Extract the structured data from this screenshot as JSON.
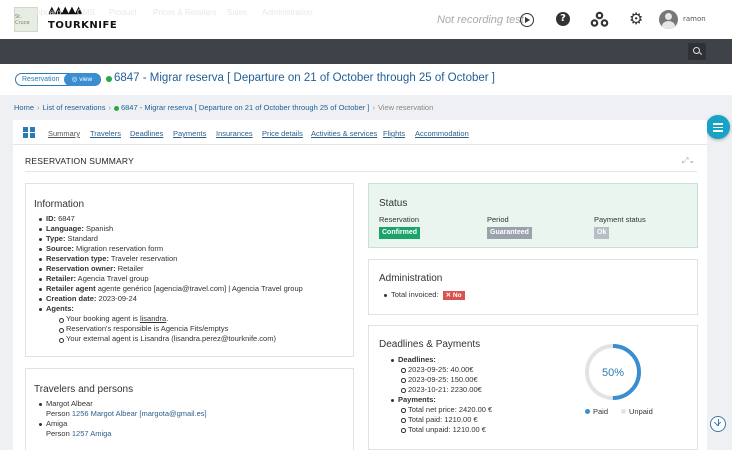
{
  "header": {
    "logo_small_text": "St. Cruce",
    "brand": "TOURKNIFE",
    "recording_status": "Not recording test",
    "username": "ramon"
  },
  "nav": {
    "items": [
      "Dashboard",
      "CMS",
      "Product",
      "Prices & Retailers",
      "Sales",
      "Administration"
    ]
  },
  "title": {
    "pill_label": "Reservation",
    "pill_view": "◎ view",
    "text": "6847 - Migrar reserva [ Departure on 21 of October through 25 of October ]"
  },
  "breadcrumb": {
    "home": "Home",
    "list": "List of reservations",
    "reservation": "6847 - Migrar reserva [ Departure on 21 of October through 25 of October ]",
    "current": "View reservation"
  },
  "tabs": [
    "Summary",
    "Travelers",
    "Deadlines",
    "Payments",
    "Insurances",
    "Price details",
    "Activities & services",
    "Flights",
    "Accommodation"
  ],
  "summary": {
    "title": "RESERVATION SUMMARY"
  },
  "information": {
    "title": "Information",
    "rows": [
      {
        "label": "ID:",
        "value": " 6847"
      },
      {
        "label": "Language:",
        "value": " Spanish"
      },
      {
        "label": "Type:",
        "value": " Standard"
      },
      {
        "label": "Source:",
        "value": " Migration reservation form"
      },
      {
        "label": "Reservation type:",
        "value": " Traveler reservation"
      },
      {
        "label": "Reservation owner:",
        "value": " Retailer"
      },
      {
        "label": "Retailer:",
        "value": " Agencia Travel group"
      },
      {
        "label": "Retailer agent",
        "value": " agente genérico [agencia@travel.com] | Agencia Travel group"
      },
      {
        "label": "Creation date:",
        "value": " 2023-09-24"
      },
      {
        "label": "Agents:",
        "value": ""
      }
    ],
    "agents": {
      "booking_prefix": "Your booking agent is ",
      "booking_name": "lisandra",
      "booking_suffix": ".",
      "responsible": "Reservation's responsible is Agencia Fits/emptys",
      "external": "Your external agent is Lisandra (lisandra.perez@tourknife.com)"
    }
  },
  "travelers": {
    "title": "Travelers and persons",
    "people": [
      {
        "name": "Margot Albear",
        "prefix": "Person ",
        "link": "1256 Margot Albear [margota@gmail.es]"
      },
      {
        "name": "Amiga",
        "prefix": "Person ",
        "link": "1257 Amiga"
      }
    ]
  },
  "status": {
    "title": "Status",
    "reservation_label": "Reservation",
    "reservation_value": "Confirmed",
    "period_label": "Period",
    "period_value": "Guaranteed",
    "payment_label": "Payment status",
    "payment_value": "Ok",
    "colors": {
      "confirmed": "#1aa36b",
      "guaranteed": "#9aa3ab",
      "ok": "#b7bec4"
    }
  },
  "administration": {
    "title": "Administration",
    "total_invoiced_label": "Total invoiced:",
    "total_invoiced_value": "✕ No"
  },
  "deadlines": {
    "title": "Deadlines & Payments",
    "deadlines_label": "Deadlines:",
    "deadline_items": [
      "2023-09-25: 40.00€",
      "2023-09-25: 150.00€",
      "2023-10-21: 2230.00€"
    ],
    "payments_label": "Payments:",
    "payment_items": [
      "Total net price: 2420.00 €",
      "Total paid: 1210.00 €",
      "Total unpaid: 1210.00 €"
    ],
    "donut_percent": 50,
    "donut_label": "50%",
    "legend_paid": "Paid",
    "legend_unpaid": "Unpaid",
    "colors": {
      "paid": "#3a8ed0",
      "unpaid": "#e3e3e3"
    }
  }
}
